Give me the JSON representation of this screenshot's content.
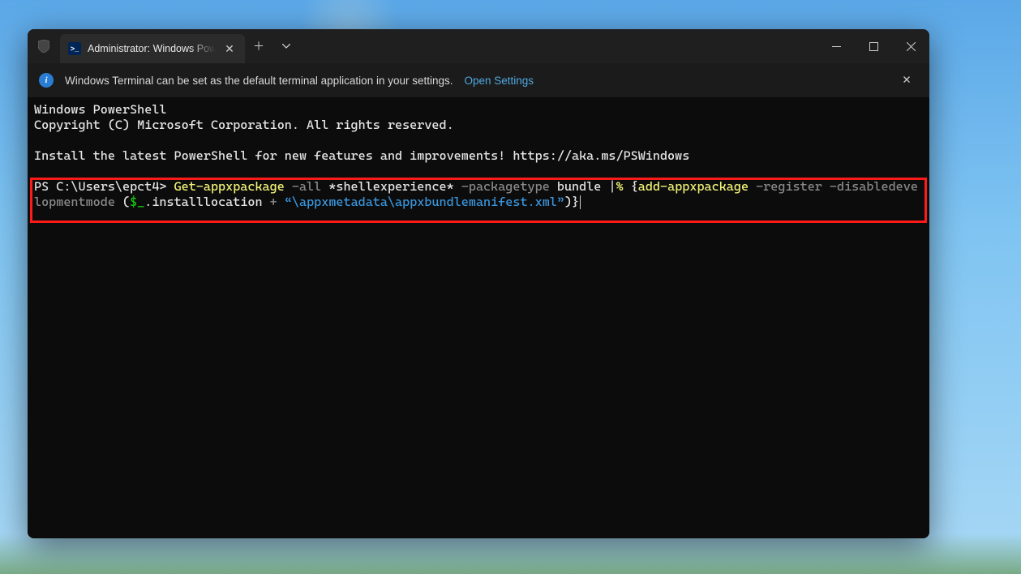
{
  "tab": {
    "title": "Administrator: Windows PowerShell"
  },
  "infobar": {
    "message": "Windows Terminal can be set as the default terminal application in your settings.",
    "open_settings": "Open Settings"
  },
  "terminal": {
    "banner_line1": "Windows PowerShell",
    "banner_line2": "Copyright (C) Microsoft Corporation. All rights reserved.",
    "install_hint": "Install the latest PowerShell for new features and improvements! https://aka.ms/PSWindows",
    "prompt": "PS C:\\Users\\epct4> ",
    "cmd": {
      "p1_get": "Get-appxpackage",
      "p2_all": " -all ",
      "p3_filter": "*shellexperience*",
      "p4_pkgtype": " -packagetype ",
      "p5_bundle": "bundle ",
      "p6_pipe": "|",
      "p7_percent": "% ",
      "p8_brace_open": "{",
      "p9_add": "add-appxpackage",
      "p10_flags": " -register -disabledevelopmentmode ",
      "p11_paren_open": "(",
      "p12_var": "$_",
      "p13_dot": ".",
      "p14_prop": "installlocation",
      "p15_plus": " + ",
      "p16_str": "“\\appxmetadata\\appxbundlemanifest.xml”",
      "p17_close": ")}"
    }
  }
}
